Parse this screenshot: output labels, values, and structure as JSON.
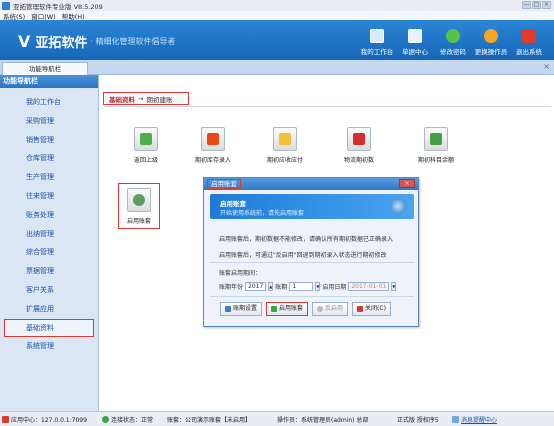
{
  "window": {
    "title": "亚拓管理软件专业版 V8.5.209",
    "controls": [
      "—",
      "□",
      "×"
    ]
  },
  "menubar": [
    "系统(S)",
    "窗口(W)",
    "帮助(H)"
  ],
  "banner": {
    "logo_mark": "V",
    "brand": "亚拓软件",
    "slogan": "· 精细化管理软件倡导者"
  },
  "topnav": [
    {
      "label": "我的工作台",
      "icon": "monitor-icon",
      "color": "#d7e9ff"
    },
    {
      "label": "单据中心",
      "icon": "list-icon",
      "color": "#e8f1ff"
    },
    {
      "label": "修改密码",
      "icon": "key-icon",
      "color": "#5bbf4b"
    },
    {
      "label": "更换操作员",
      "icon": "user-icon",
      "color": "#f5a623"
    },
    {
      "label": "退出系统",
      "icon": "power-icon",
      "color": "#e03b2f"
    }
  ],
  "tab": {
    "label": "功能导航栏",
    "close": "×"
  },
  "sidebar": {
    "header": "功能导航栏",
    "items": [
      {
        "label": "我的工作台"
      },
      {
        "label": "采购管理"
      },
      {
        "label": "销售管理"
      },
      {
        "label": "仓库管理"
      },
      {
        "label": "生产管理"
      },
      {
        "label": "往来管理"
      },
      {
        "label": "账务处理"
      },
      {
        "label": "出纳管理"
      },
      {
        "label": "综合管理"
      },
      {
        "label": "票据管理"
      },
      {
        "label": "客户关系"
      },
      {
        "label": "扩展应用"
      },
      {
        "label": "基础资料"
      },
      {
        "label": "系统管理"
      }
    ],
    "active_index": 12
  },
  "breadcrumb": {
    "level1": "基础资料",
    "arrow": "→",
    "level2": "期初建账"
  },
  "tiles": [
    {
      "label": "返回上级",
      "icon": "up-arrow-icon",
      "color": "#4caf50"
    },
    {
      "label": "期初库存录入",
      "icon": "house-icon",
      "color": "#e64a19"
    },
    {
      "label": "期初应收应付",
      "icon": "coins-icon",
      "color": "#f2c037"
    },
    {
      "label": "物流期初数",
      "icon": "truck-icon",
      "color": "#d32f2f"
    },
    {
      "label": "期初科目余额",
      "icon": "document-icon",
      "color": "#43a047"
    },
    {
      "label": "启用账套",
      "icon": "database-icon",
      "color": "#5f9e5f"
    }
  ],
  "dialog": {
    "title": "启用账套",
    "close": "×",
    "header_title": "启用账套",
    "header_sub": "开始使用系统前，请先启用账套",
    "line1": "启用账套后，期初数据不能修改，请确认所有期初数据已正确录入",
    "line2": "启用账套后，可通过\"反启用\"回退到期初录入状态进行期初修改",
    "settings_title": "账套启用期间：",
    "year_label": "账期年份",
    "year_value": "2017",
    "period_label": "账期",
    "period_value": "1",
    "date_label": "启用日期",
    "date_value": "2017-01-01",
    "btn_setup": "账期设置",
    "btn_enable": "启用账套",
    "btn_disable": "反启用",
    "btn_close": "关闭(C)"
  },
  "statusbar": {
    "center": "应用中心：127.0.0.1:7099",
    "connection": "连接状态：正常",
    "account": "账套：公司演示账套【未启用】",
    "operator": "操作员：系统管理员(admin) 总部",
    "edition": "正式版 授权序5",
    "message": "消息提醒中心"
  }
}
